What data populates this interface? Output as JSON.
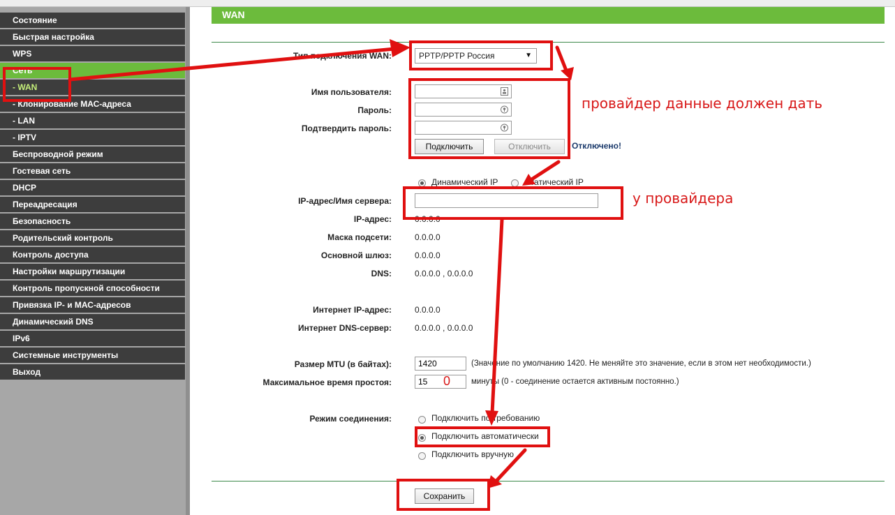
{
  "menu": [
    {
      "label": "Состояние"
    },
    {
      "label": "Быстрая настройка"
    },
    {
      "label": "WPS"
    },
    {
      "label": "Сеть"
    },
    {
      "label": "- WAN"
    },
    {
      "label": "- Клонирование МАС-адреса"
    },
    {
      "label": "- LAN"
    },
    {
      "label": "- IPTV"
    },
    {
      "label": "Беспроводной режим"
    },
    {
      "label": "Гостевая сеть"
    },
    {
      "label": "DHCP"
    },
    {
      "label": "Переадресация"
    },
    {
      "label": "Безопасность"
    },
    {
      "label": "Родительский контроль"
    },
    {
      "label": "Контроль доступа"
    },
    {
      "label": "Настройки маршрутизации"
    },
    {
      "label": "Контроль пропускной способности"
    },
    {
      "label": "Привязка IP- и МАС-адресов"
    },
    {
      "label": "Динамический DNS"
    },
    {
      "label": "IPv6"
    },
    {
      "label": "Системные инструменты"
    },
    {
      "label": "Выход"
    }
  ],
  "page_title": "WAN",
  "wan": {
    "type_label": "Тип подключения WAN:",
    "type_value": "PPTP/PPTP Россия",
    "username_label": "Имя пользователя:",
    "password_label": "Пароль:",
    "confirm_label": "Подтвердить пароль:",
    "connect_button": "Подключить",
    "disconnect_button": "Отключить",
    "status": "Отключено!",
    "dynamic_ip": "Динамический IP",
    "static_ip": "Статический IP",
    "server_label": "IP-адрес/Имя сервера:",
    "ip_label": "IP-адрес:",
    "ip_value": "0.0.0.0",
    "mask_label": "Маска подсети:",
    "mask_value": "0.0.0.0",
    "gateway_label": "Основной шлюз:",
    "gateway_value": "0.0.0.0",
    "dns_label": "DNS:",
    "dns_value": "0.0.0.0 , 0.0.0.0",
    "inet_ip_label": "Интернет IP-адрес:",
    "inet_ip_value": "0.0.0.0",
    "inet_dns_label": "Интернет DNS-сервер:",
    "inet_dns_value": "0.0.0.0 , 0.0.0.0",
    "mtu_label": "Размер MTU (в байтах):",
    "mtu_value": "1420",
    "mtu_hint": "(Значение по умолчанию 1420. Не меняйте это значение, если в этом нет необходимости.)",
    "idle_label": "Максимальное время простоя:",
    "idle_value": "15",
    "idle_hint": "минуты (0 - соединение остается активным постоянно.)",
    "mode_label": "Режим соединения:",
    "mode_demand": "Подключить по требованию",
    "mode_auto": "Подключить автоматически",
    "mode_manual": "Подключить вручную",
    "save_button": "Сохранить"
  },
  "annotations": {
    "provider_data": "провайдер данные должен дать",
    "from_provider": "у провайдера",
    "zero": "0"
  },
  "colors": {
    "accent_green": "#6cbb3c",
    "menu_dark": "#3d3d3d",
    "annotation_red": "#e01010"
  }
}
